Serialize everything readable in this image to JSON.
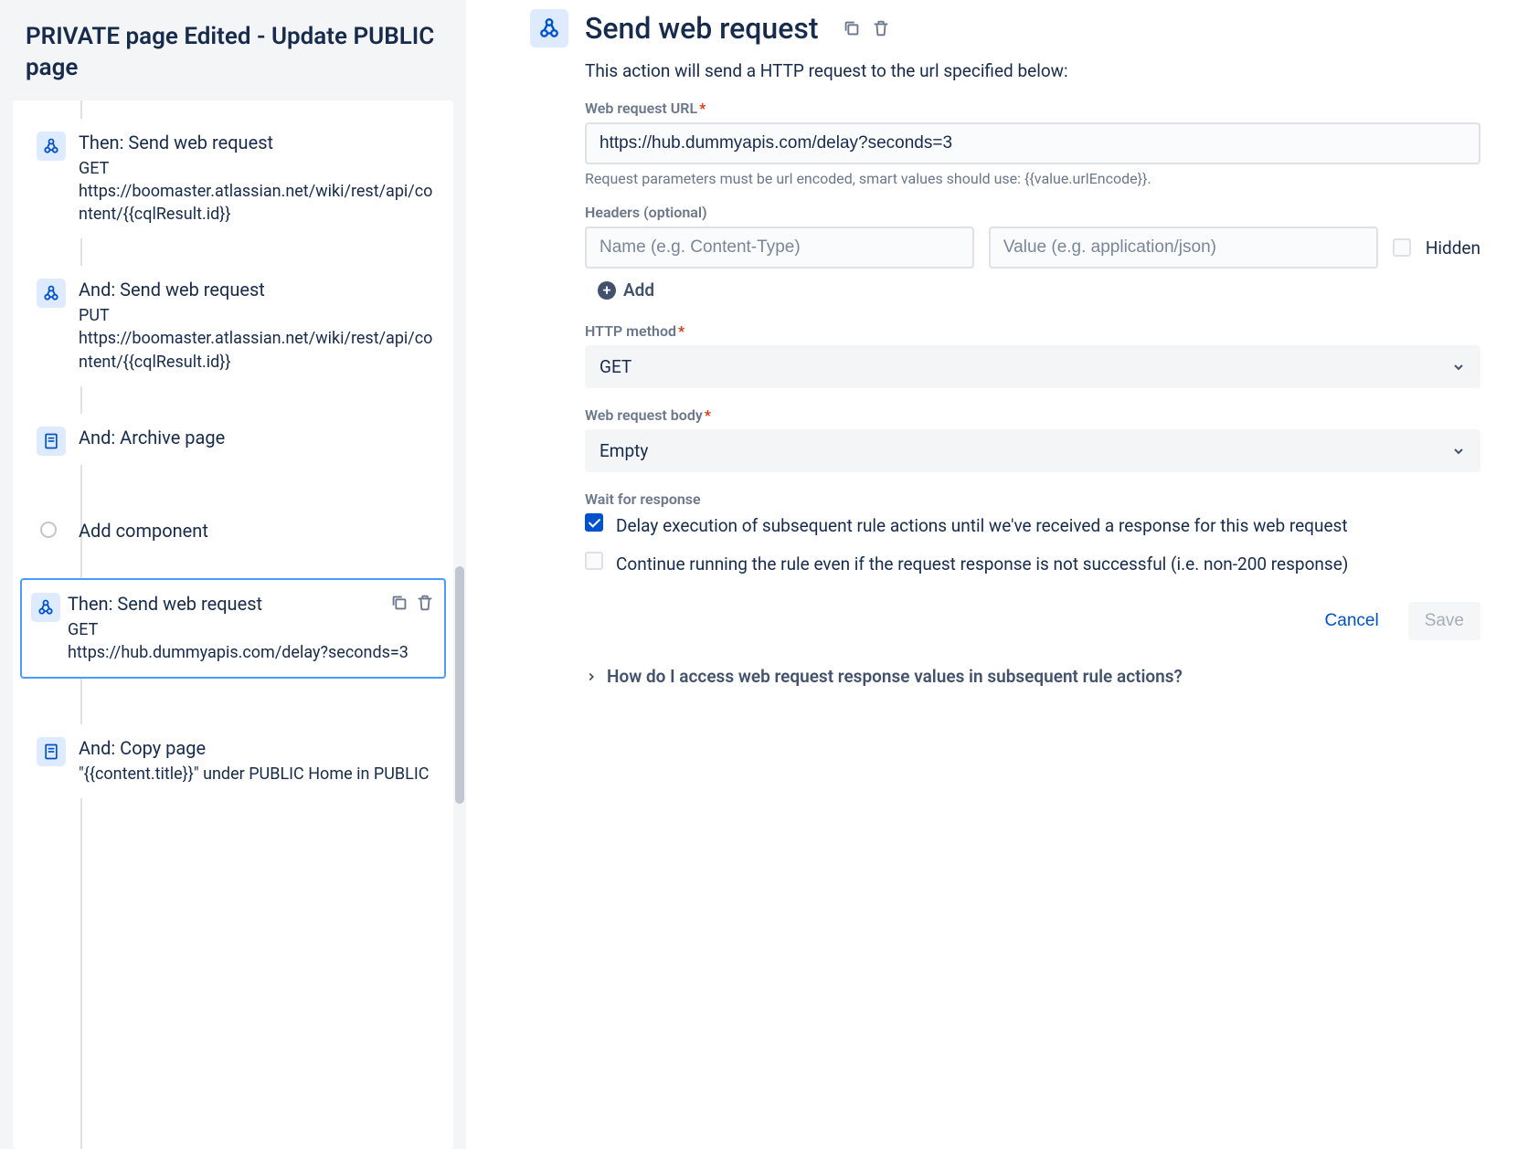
{
  "sidebar": {
    "rule_name": "PRIVATE page Edited - Update PUBLIC page",
    "items": [
      {
        "title": "Then: Send web request",
        "method": "GET",
        "url": "https://boomaster.atlassian.net/wiki/rest/api/content/{{cqlResult.id}}",
        "icon": "webhook"
      },
      {
        "title": "And: Send web request",
        "method": "PUT",
        "url": "https://boomaster.atlassian.net/wiki/rest/api/content/{{cqlResult.id}}",
        "icon": "webhook"
      },
      {
        "title": "And: Archive page",
        "icon": "page"
      }
    ],
    "add_component": "Add component",
    "selected": {
      "title": "Then: Send web request",
      "method": "GET",
      "url": "https://hub.dummyapis.com/delay?seconds=3"
    },
    "after": [
      {
        "title": "And: Copy page",
        "sub": "\"{{content.title}}\" under PUBLIC Home in PUBLIC",
        "icon": "page"
      }
    ]
  },
  "main": {
    "title": "Send web request",
    "description": "This action will send a HTTP request to the url specified below:",
    "url_label": "Web request URL",
    "url_value": "https://hub.dummyapis.com/delay?seconds=3",
    "url_hint": "Request parameters must be url encoded, smart values should use: {{value.urlEncode}}.",
    "headers_label": "Headers (optional)",
    "header_name_ph": "Name (e.g. Content-Type)",
    "header_value_ph": "Value (e.g. application/json)",
    "hidden_label": "Hidden",
    "add_label": "Add",
    "method_label": "HTTP method",
    "method_value": "GET",
    "body_label": "Web request body",
    "body_value": "Empty",
    "wait_label": "Wait for response",
    "wait_opt1": "Delay execution of subsequent rule actions until we've received a response for this web request",
    "wait_opt2": "Continue running the rule even if the request response is not successful (i.e. non-200 response)",
    "cancel": "Cancel",
    "save": "Save",
    "disclosure": "How do I access web request response values in subsequent rule actions?"
  }
}
